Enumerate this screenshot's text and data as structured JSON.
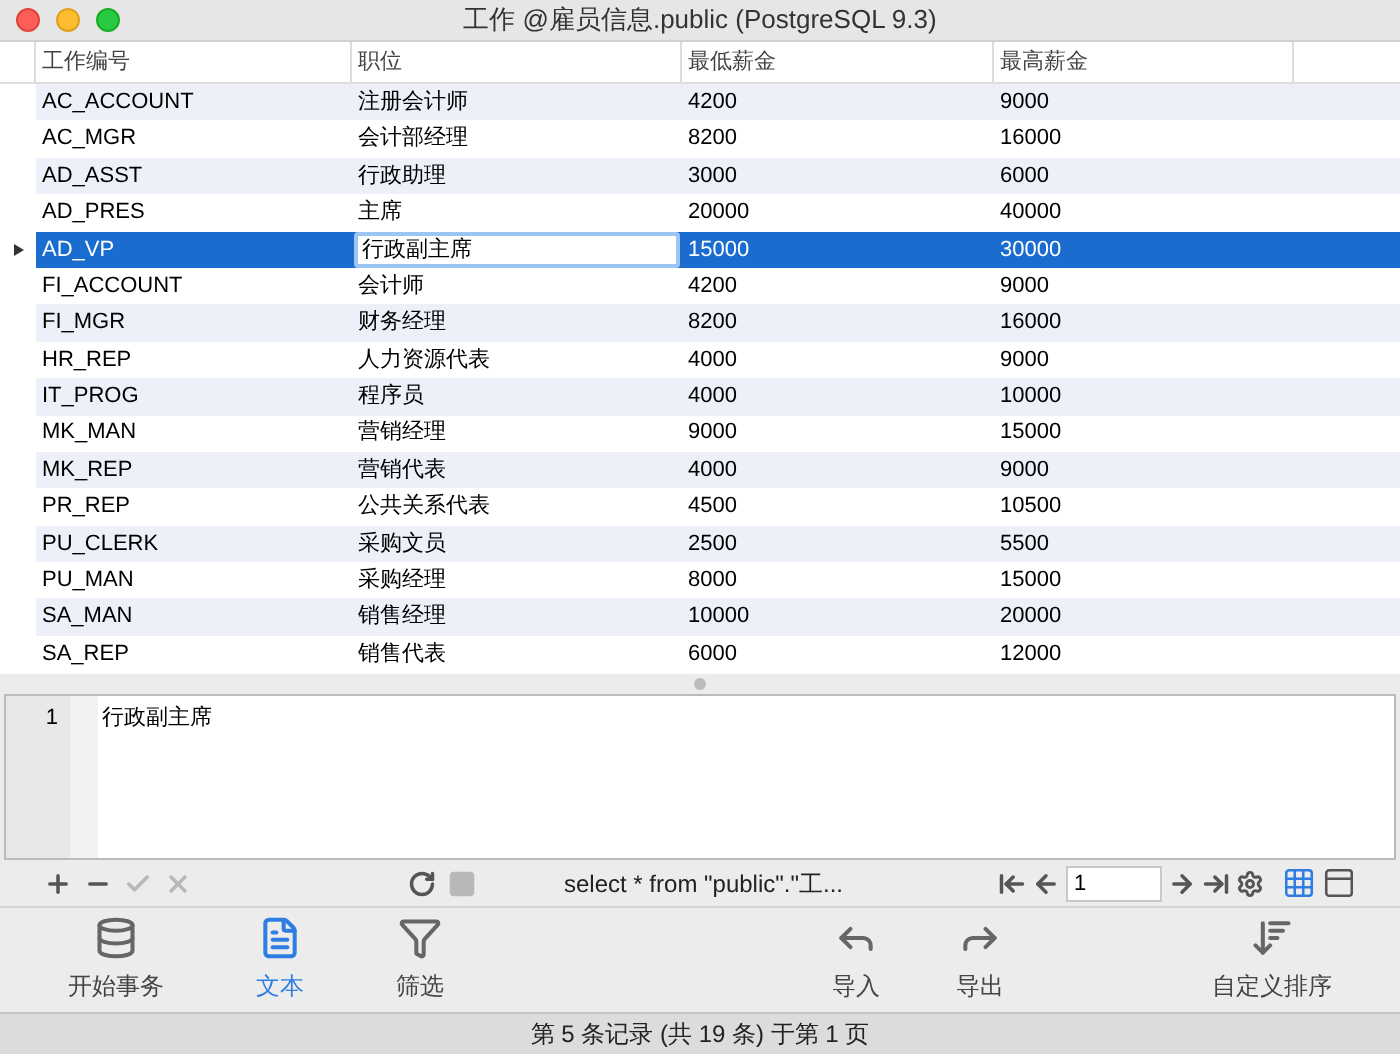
{
  "window": {
    "title": "工作 @雇员信息.public (PostgreSQL 9.3)"
  },
  "table": {
    "columns": [
      "工作编号",
      "职位",
      "最低薪金",
      "最高薪金"
    ],
    "rows": [
      {
        "cells": [
          "AC_ACCOUNT",
          "注册会计师",
          "4200",
          "9000"
        ],
        "selected": false,
        "editing": false
      },
      {
        "cells": [
          "AC_MGR",
          "会计部经理",
          "8200",
          "16000"
        ],
        "selected": false,
        "editing": false
      },
      {
        "cells": [
          "AD_ASST",
          "行政助理",
          "3000",
          "6000"
        ],
        "selected": false,
        "editing": false
      },
      {
        "cells": [
          "AD_PRES",
          "主席",
          "20000",
          "40000"
        ],
        "selected": false,
        "editing": false
      },
      {
        "cells": [
          "AD_VP",
          "行政副主席",
          "15000",
          "30000"
        ],
        "selected": true,
        "editing": true
      },
      {
        "cells": [
          "FI_ACCOUNT",
          "会计师",
          "4200",
          "9000"
        ],
        "selected": false,
        "editing": false
      },
      {
        "cells": [
          "FI_MGR",
          "财务经理",
          "8200",
          "16000"
        ],
        "selected": false,
        "editing": false
      },
      {
        "cells": [
          "HR_REP",
          "人力资源代表",
          "4000",
          "9000"
        ],
        "selected": false,
        "editing": false
      },
      {
        "cells": [
          "IT_PROG",
          "程序员",
          "4000",
          "10000"
        ],
        "selected": false,
        "editing": false
      },
      {
        "cells": [
          "MK_MAN",
          "营销经理",
          "9000",
          "15000"
        ],
        "selected": false,
        "editing": false
      },
      {
        "cells": [
          "MK_REP",
          "营销代表",
          "4000",
          "9000"
        ],
        "selected": false,
        "editing": false
      },
      {
        "cells": [
          "PR_REP",
          "公共关系代表",
          "4500",
          "10500"
        ],
        "selected": false,
        "editing": false
      },
      {
        "cells": [
          "PU_CLERK",
          "采购文员",
          "2500",
          "5500"
        ],
        "selected": false,
        "editing": false
      },
      {
        "cells": [
          "PU_MAN",
          "采购经理",
          "8000",
          "15000"
        ],
        "selected": false,
        "editing": false
      },
      {
        "cells": [
          "SA_MAN",
          "销售经理",
          "10000",
          "20000"
        ],
        "selected": false,
        "editing": false
      },
      {
        "cells": [
          "SA_REP",
          "销售代表",
          "6000",
          "12000"
        ],
        "selected": false,
        "editing": false
      }
    ]
  },
  "editor": {
    "line_number": "1",
    "text": "行政副主席"
  },
  "edit_toolbar": {
    "buttons": [
      {
        "kind": "add",
        "disabled": false
      },
      {
        "kind": "remove",
        "disabled": false
      },
      {
        "kind": "apply",
        "disabled": true
      },
      {
        "kind": "discard",
        "disabled": true
      },
      {
        "kind": "refresh",
        "disabled": false
      },
      {
        "kind": "stop",
        "disabled": true
      }
    ],
    "query": "select * from \"public\".\"工...",
    "page_field": "1",
    "views": [
      {
        "kind": "grid",
        "selected": true
      },
      {
        "kind": "form",
        "selected": false
      }
    ]
  },
  "tools_left": [
    {
      "kind": "transaction",
      "label": "开始事务",
      "selected": false
    },
    {
      "kind": "text",
      "label": "文本",
      "selected": true
    },
    {
      "kind": "filter",
      "label": "筛选",
      "selected": false
    }
  ],
  "tools_right": [
    {
      "kind": "import",
      "label": "导入",
      "selected": false
    },
    {
      "kind": "export",
      "label": "导出",
      "selected": false
    },
    {
      "kind": "sort",
      "label": "自定义排序",
      "selected": false
    }
  ],
  "status_bar": "第 5 条记录 (共 19 条) 于第 1 页"
}
